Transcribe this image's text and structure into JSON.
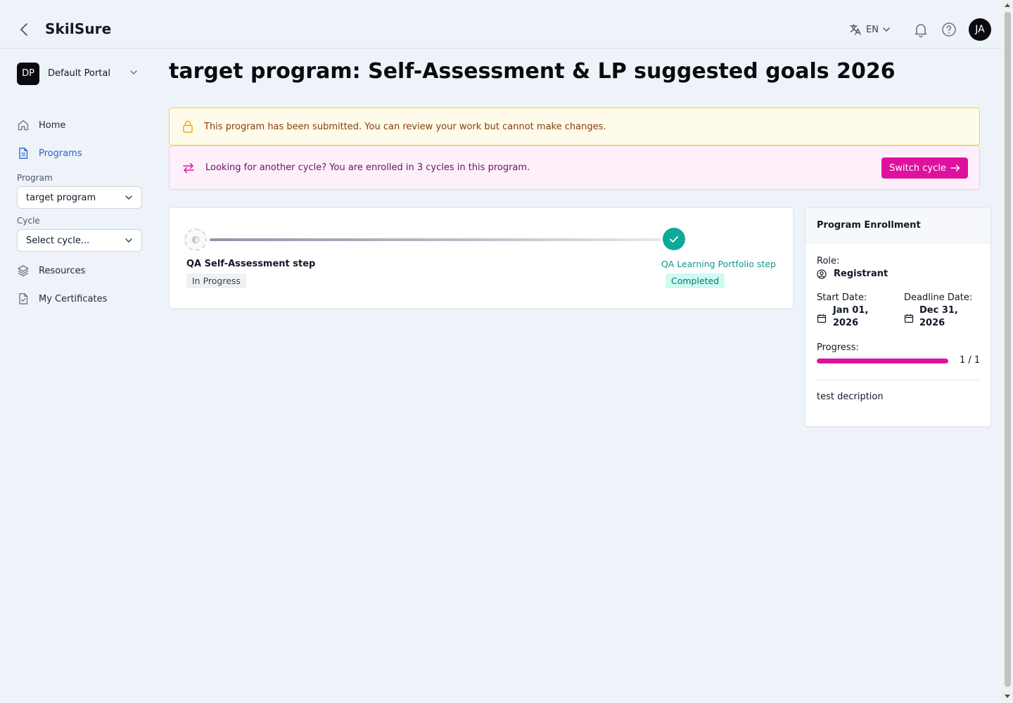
{
  "header": {
    "app_title": "SkilSure",
    "language": "EN",
    "avatar_initials": "JA"
  },
  "sidebar": {
    "portal": {
      "initials": "DP",
      "name": "Default Portal"
    },
    "nav": [
      {
        "label": "Home",
        "icon": "home-icon"
      },
      {
        "label": "Programs",
        "icon": "document-icon",
        "active": true
      },
      {
        "label": "Resources",
        "icon": "layers-icon"
      },
      {
        "label": "My Certificates",
        "icon": "certificate-icon"
      }
    ],
    "program_label": "Program",
    "program_value": "target program",
    "cycle_label": "Cycle",
    "cycle_placeholder": "Select cycle..."
  },
  "main": {
    "title": "target program: Self-Assessment & LP suggested goals 2026",
    "submitted_alert": "This program has been submitted. You can review your work but cannot make changes.",
    "cycle_alert": "Looking for another cycle? You are enrolled in 3 cycles in this program.",
    "switch_cycle_label": "Switch cycle",
    "steps": [
      {
        "title": "QA Self-Assessment step",
        "status": "In Progress"
      },
      {
        "title": "QA Learning Portfolio step",
        "status": "Completed"
      }
    ]
  },
  "enrollment": {
    "heading": "Program Enrollment",
    "role_label": "Role:",
    "role_value": "Registrant",
    "start_label": "Start Date:",
    "start_value_line1": "Jan 01,",
    "start_value_line2": "2026",
    "deadline_label": "Deadline Date:",
    "deadline_value_line1": "Dec 31,",
    "deadline_value_line2": "2026",
    "progress_label": "Progress:",
    "progress_text": "1 / 1",
    "progress_fraction": 1.0,
    "description": "test decription"
  },
  "colors": {
    "accent": "#e0109e",
    "link": "#2563c9",
    "success": "#10a89a",
    "warning_border": "#f4d046"
  }
}
